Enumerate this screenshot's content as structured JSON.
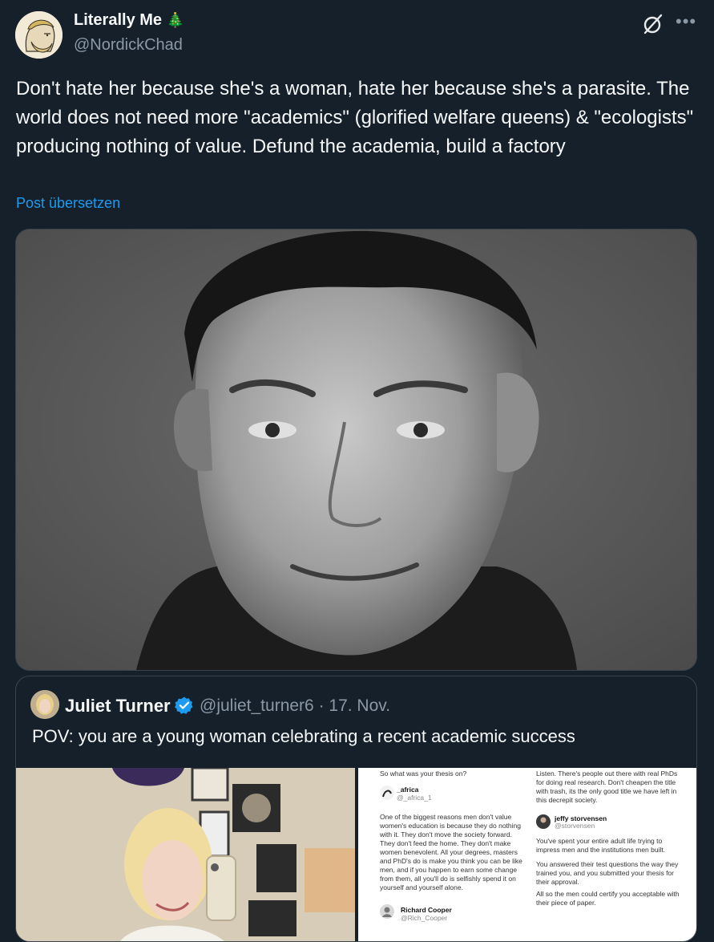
{
  "author": {
    "name": "Literally Me",
    "emoji": "🎄",
    "handle": "@NordickChad"
  },
  "post": {
    "text": "Don't hate her because she's a woman, hate her because she's a parasite. The world does not need more \"academics\" (glorified welfare queens) & \"ecologists\" producing nothing of value. Defund the academia, build a factory",
    "translate_label": "Post übersetzen"
  },
  "icons": {
    "grok": "grok-icon",
    "more": "more-dots-icon",
    "verified": "verified-badge-icon"
  },
  "colors": {
    "background": "#15202b",
    "link": "#1d9bf0",
    "verified": "#1d9bf0",
    "muted": "#8b98a5"
  },
  "quote": {
    "name": "Juliet Turner",
    "handle": "@juliet_turner6",
    "date": "17. Nov.",
    "text": "POV: you are a young woman celebrating a recent academic success",
    "screenshot": {
      "q1": "So what was your thesis on?",
      "a1_name": "_africa",
      "a1_handle": "@_africa_1",
      "a1_text": "One of the biggest reasons men don't value women's education is because they do nothing with it. They don't move the society forward. They don't feed the home. They don't make women benevolent. All your degrees, masters and PhD's do is make you think you can be like men, and if you happen to earn some change from them, all you'll do is selfishly spend it on yourself and yourself alone.",
      "a2_name": "Richard Cooper",
      "a2_handle": "@Rich_Cooper",
      "b1_text": "Listen. There's people out there with real PhDs for doing real research. Don't cheapen the title with trash, its the only good title we have left in this decrepit society.",
      "b2_name": "jeffy storvensen",
      "b2_handle": "@storvensen",
      "b2_text1": "You've spent your entire adult life trying to impress men and the institutions men built.",
      "b2_text2": "You answered their test questions the way they trained you, and you submitted your thesis for their approval.",
      "b2_text3": "All so the men could certify you acceptable with their piece of paper."
    }
  }
}
